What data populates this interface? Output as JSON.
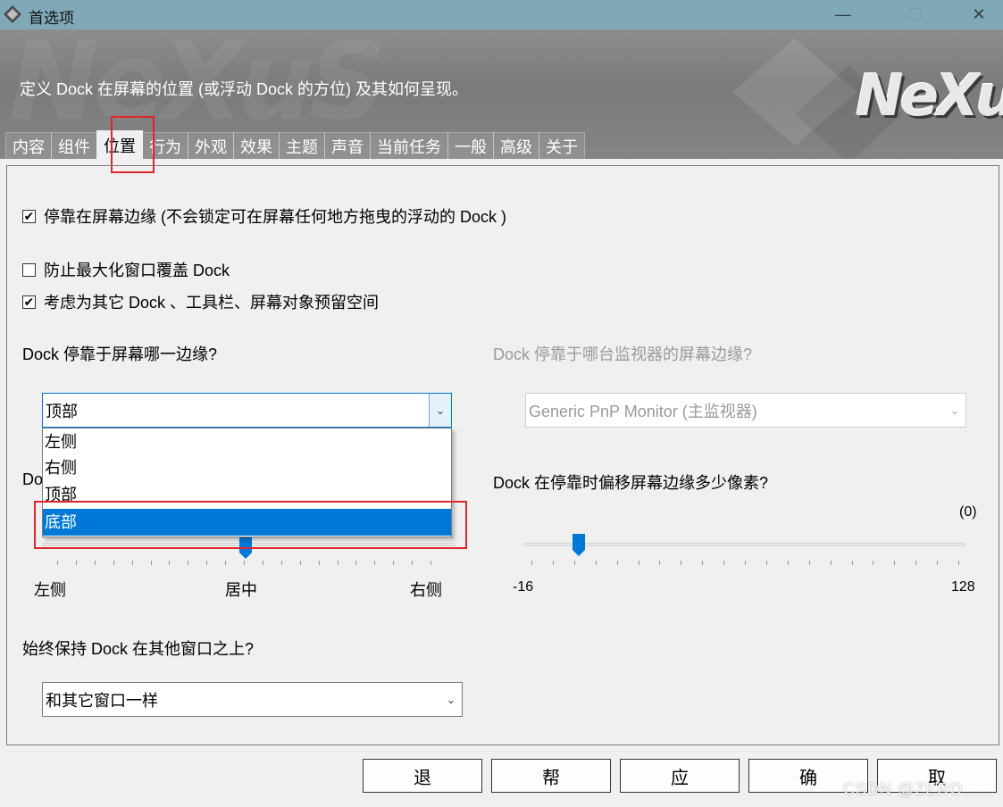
{
  "window": {
    "title": "首选项",
    "controls": [
      "—",
      "☐",
      "✕"
    ]
  },
  "banner": {
    "watermark": "NeXuS",
    "description": "定义 Dock 在屏幕的位置 (或浮动 Dock 的方位) 及其如何呈现。",
    "logo": "NeXuS"
  },
  "tabs": [
    "内容",
    "组件",
    "位置",
    "行为",
    "外观",
    "效果",
    "主题",
    "声音",
    "当前任务",
    "一般",
    "高级",
    "关于"
  ],
  "active_tab": "位置",
  "options": {
    "dock_edge": {
      "label": "停靠在屏幕边缘 (不会锁定可在屏幕任何地方拖曳的浮动的 Dock )",
      "checked": true
    },
    "prevent_cover": {
      "label": "防止最大化窗口覆盖 Dock",
      "checked": false
    },
    "reserve_space": {
      "label": "考虑为其它 Dock 、工具栏、屏幕对象预留空间",
      "checked": true
    }
  },
  "edge_question": "Dock 停靠于屏幕哪一边缘?",
  "edge_combo": {
    "value": "顶部",
    "options": [
      "左侧",
      "右侧",
      "顶部",
      "底部"
    ],
    "hovered": "底部"
  },
  "monitor_question": "Dock 停靠于哪台监视器的屏幕边缘?",
  "monitor_combo": {
    "value": "Generic PnP Monitor (主监视器)"
  },
  "position_slider": {
    "label_partial": "Do",
    "min_label": "左侧",
    "mid_label": "居中",
    "max_label": "右侧",
    "value_fraction": 0.5
  },
  "offset_question": "Dock 在停靠时偏移屏幕边缘多少像素?",
  "offset_slider": {
    "value_text": "(0)",
    "min": -16,
    "max": 128,
    "value": 0,
    "min_label": "-16",
    "max_label": "128"
  },
  "ontop_question": "始终保持 Dock 在其他窗口之上?",
  "ontop_combo": {
    "value": "和其它窗口一样"
  },
  "buttons": [
    "退",
    "帮",
    "应",
    "确",
    "取"
  ],
  "watermark": "CSDN @ZERO......",
  "colors": {
    "titlebar": "#7fa9b8",
    "accent": "#0078d7",
    "highlight": "#e0262b"
  }
}
